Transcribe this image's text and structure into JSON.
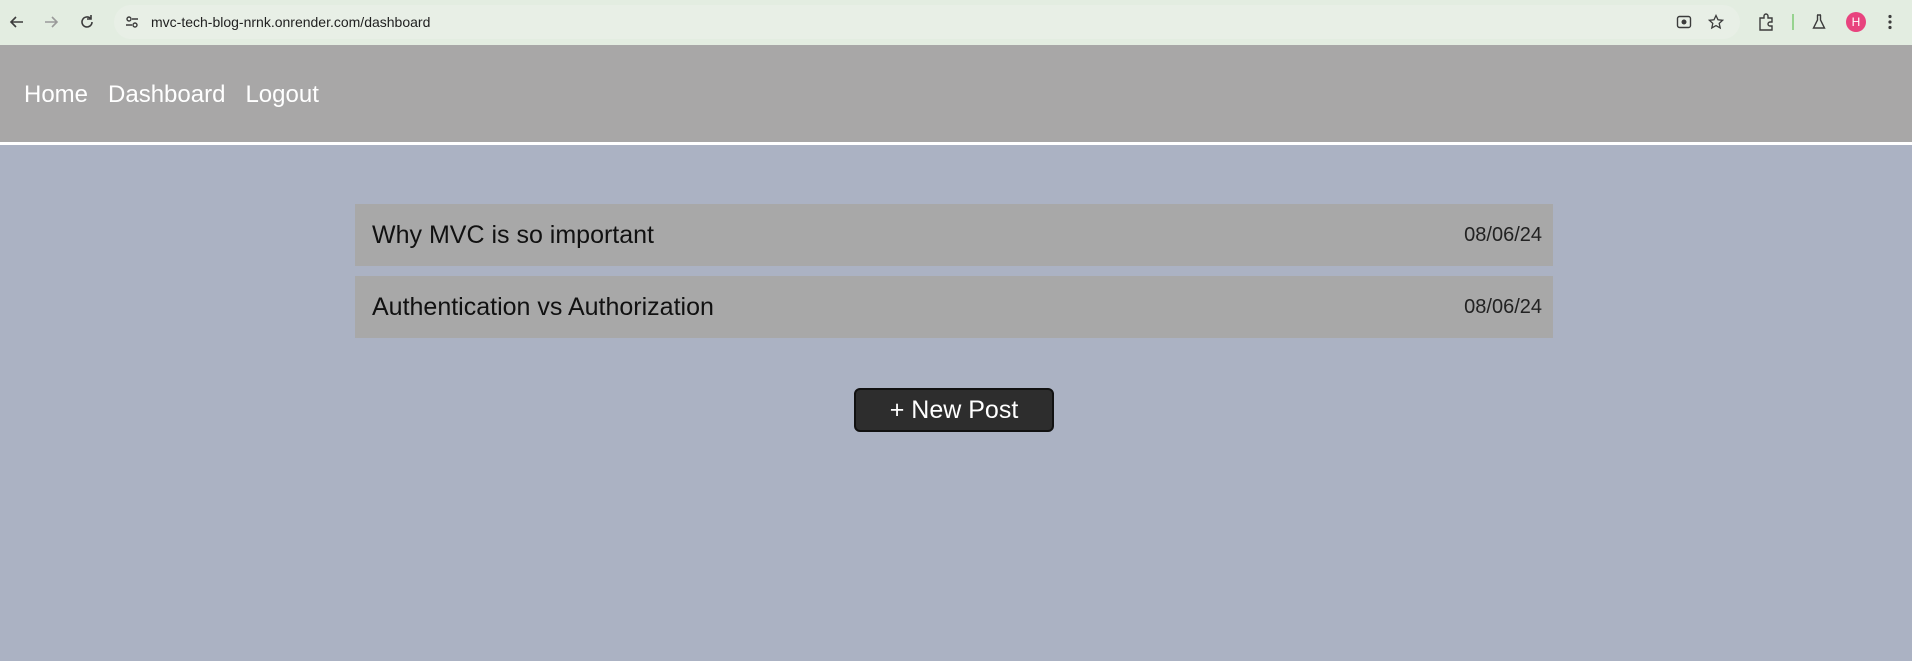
{
  "browser": {
    "url": "mvc-tech-blog-nrnk.onrender.com/dashboard",
    "avatar_letter": "H",
    "icons": [
      "back-arrow-icon",
      "forward-arrow-icon",
      "reload-icon",
      "site-settings-icon",
      "lens-icon",
      "bookmark-star-icon",
      "extensions-icon",
      "labs-flask-icon",
      "more-menu-icon"
    ]
  },
  "nav": {
    "home": "Home",
    "dashboard": "Dashboard",
    "logout": "Logout"
  },
  "posts": [
    {
      "title": "Why MVC is so important",
      "date": "08/06/24"
    },
    {
      "title": "Authentication vs Authorization",
      "date": "08/06/24"
    }
  ],
  "actions": {
    "new_post": "+ New Post"
  },
  "colors": {
    "page_bg": "#abb2c3",
    "header_bg": "#a8a7a7",
    "post_bg": "#a8a8a8",
    "button_bg": "#2d2d2d"
  }
}
